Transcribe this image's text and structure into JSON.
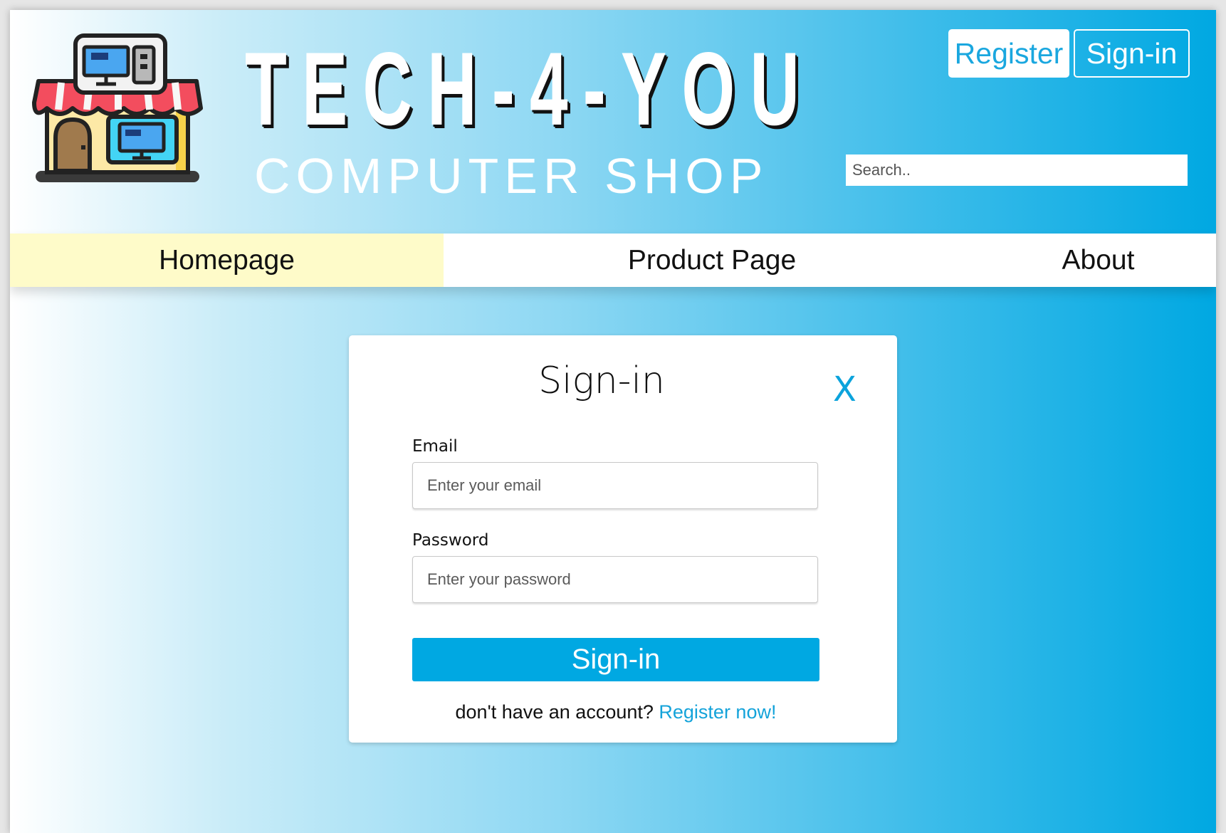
{
  "header": {
    "logo": {
      "icon": "computer-shop-icon"
    },
    "brand_title": "TECH-4-YOU",
    "brand_subtitle": "COMPUTER SHOP",
    "register_label": "Register",
    "signin_label": "Sign-in",
    "search": {
      "placeholder": "Search..",
      "value": ""
    }
  },
  "nav": {
    "items": [
      {
        "label": "Homepage",
        "active": true
      },
      {
        "label": "Product Page",
        "active": false
      },
      {
        "label": "About",
        "active": false
      }
    ]
  },
  "modal": {
    "title": "Sign-in",
    "close_label": "X",
    "email": {
      "label": "Email",
      "placeholder": "Enter your email",
      "value": ""
    },
    "password": {
      "label": "Password",
      "placeholder": "Enter your password",
      "value": ""
    },
    "submit_label": "Sign-in",
    "footer_text": "don't have an account?",
    "register_link": "Register now!"
  },
  "colors": {
    "accent": "#00a8e2",
    "active_nav": "#fefbc9",
    "link": "#14a3da"
  }
}
